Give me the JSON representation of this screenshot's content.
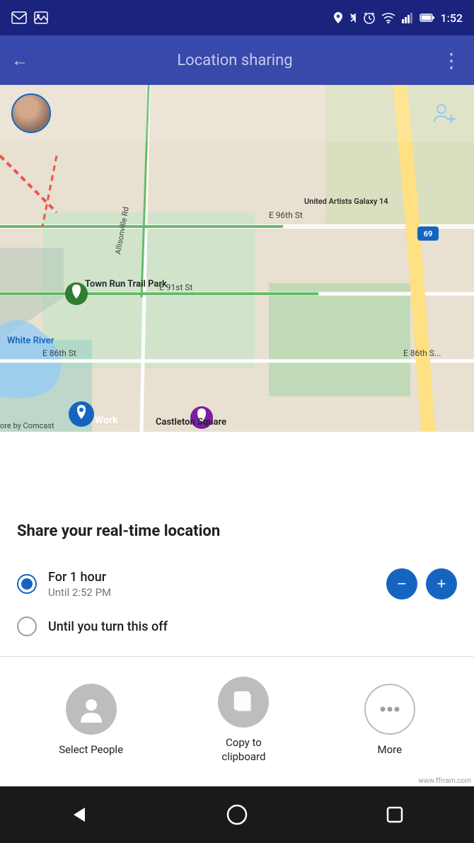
{
  "statusBar": {
    "time": "1:52",
    "icons": [
      "gmail-icon",
      "image-icon",
      "location-icon",
      "bluetooth-icon",
      "alarm-icon",
      "wifi-icon",
      "signal-icon",
      "battery-icon"
    ]
  },
  "appBar": {
    "title": "Location sharing",
    "backLabel": "←",
    "moreLabel": "⋮"
  },
  "map": {
    "labels": [
      "Town Run Trail Park",
      "E 96th St",
      "United Artists Galaxy 14",
      "White River",
      "Work",
      "E 91st St",
      "E 86th St",
      "Castleton Square",
      "ore by Comcast",
      "Allisonville Rd"
    ],
    "addPersonLabel": ""
  },
  "sheet": {
    "title": "Share your real-time location",
    "option1": {
      "label": "For 1 hour",
      "sublabel": "Until 2:52 PM",
      "selected": true
    },
    "option2": {
      "label": "Until you turn this off",
      "selected": false
    },
    "decreaseLabel": "−",
    "increaseLabel": "+"
  },
  "shareOptions": [
    {
      "id": "select-people",
      "label": "Select People",
      "icon": "person-icon"
    },
    {
      "id": "copy-clipboard",
      "label": "Copy to clipboard",
      "icon": "copy-icon"
    },
    {
      "id": "more",
      "label": "More",
      "icon": "more-dots-icon"
    }
  ],
  "bottomNav": {
    "backLabel": "◀",
    "homeLabel": "○",
    "recentLabel": "□"
  },
  "watermark": "www.ffrram.com"
}
